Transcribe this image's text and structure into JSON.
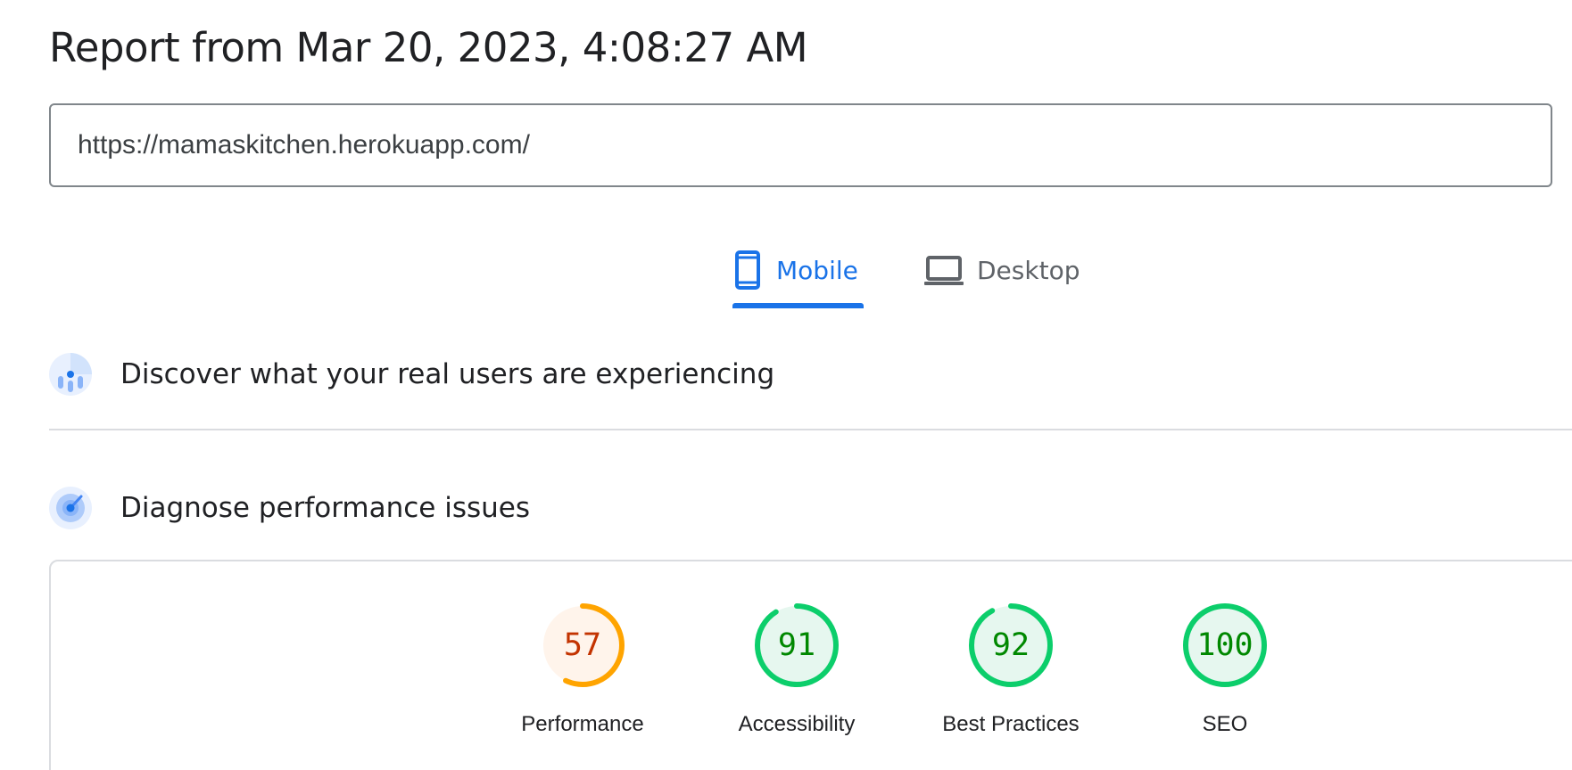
{
  "report": {
    "title": "Report from Mar 20, 2023, 4:08:27 AM"
  },
  "url_field": {
    "value": "https://mamaskitchen.herokuapp.com/"
  },
  "tabs": [
    {
      "label": "Mobile",
      "icon": "phone-icon",
      "selected": true
    },
    {
      "label": "Desktop",
      "icon": "laptop-icon",
      "selected": false
    }
  ],
  "sections": {
    "crux": {
      "title": "Discover what your real users are experiencing",
      "icon": "users-chart-icon"
    },
    "diagnose": {
      "title": "Diagnose performance issues",
      "icon": "gauge-icon"
    }
  },
  "scores": [
    {
      "label": "Performance",
      "value": "57",
      "fraction": 0.57,
      "status": "average"
    },
    {
      "label": "Accessibility",
      "value": "91",
      "fraction": 0.91,
      "status": "pass"
    },
    {
      "label": "Best Practices",
      "value": "92",
      "fraction": 0.92,
      "status": "pass"
    },
    {
      "label": "SEO",
      "value": "100",
      "fraction": 1.0,
      "status": "pass"
    }
  ],
  "colors": {
    "accent": "#1a73e8",
    "pass_stroke": "#0cce6b",
    "pass_fill": "#e6f7ef",
    "pass_text": "#008800",
    "average_stroke": "#ffa400",
    "average_fill": "#fff4eb",
    "average_text": "#c33300"
  }
}
